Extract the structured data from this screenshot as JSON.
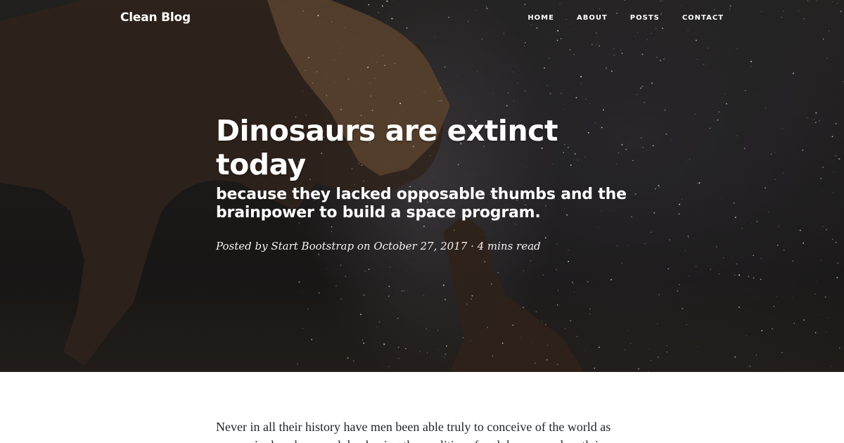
{
  "nav": {
    "brand": "Clean Blog",
    "links": [
      {
        "label": "HOME"
      },
      {
        "label": "ABOUT"
      },
      {
        "label": "POSTS"
      },
      {
        "label": "CONTACT"
      }
    ]
  },
  "post": {
    "title": "Dinosaurs are extinct today",
    "subtitle": "because they lacked opposable thumbs and the brainpower to build a space program.",
    "meta": "Posted by Start Bootstrap on October 27, 2017 · 4 mins read",
    "body": "Never in all their history have men been able truly to conceive of the world as one: a single sphere, a globe, having the qualities of a globe, a round earth in"
  },
  "colors": {
    "text_dark": "#212529",
    "white": "#ffffff"
  }
}
